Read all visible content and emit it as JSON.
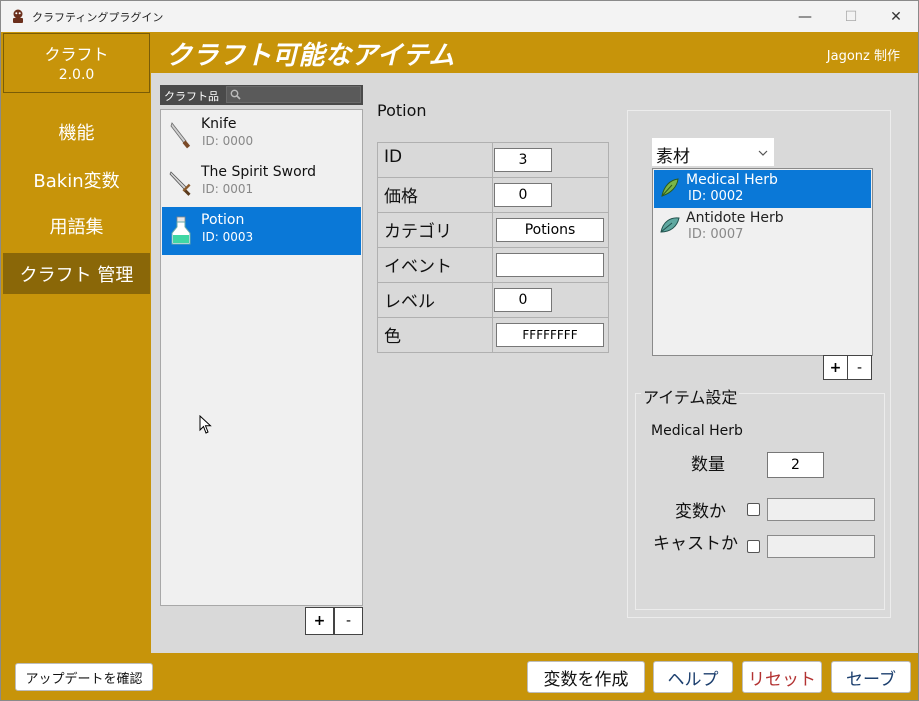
{
  "window": {
    "title": "クラフティングプラグイン",
    "controls": {
      "minimize": "—",
      "maximize": "☐",
      "close": "✕"
    }
  },
  "sidebar": {
    "app_name": "クラフト",
    "version": "2.0.0",
    "items": [
      {
        "label": "機能",
        "active": false
      },
      {
        "label": "Bakin変数",
        "active": false
      },
      {
        "label": "用語集",
        "active": false
      },
      {
        "label": "クラフト 管理",
        "active": true
      }
    ]
  },
  "header": {
    "title": "クラフト可能なアイテム",
    "author": "Jagonz 制作"
  },
  "craft_list": {
    "header_label": "クラフト品",
    "search_placeholder": "",
    "items": [
      {
        "name": "Knife",
        "id": "ID: 0000",
        "icon": "knife-icon",
        "selected": false
      },
      {
        "name": "The Spirit Sword",
        "id": "ID: 0001",
        "icon": "sword-icon",
        "selected": false
      },
      {
        "name": "Potion",
        "id": "ID: 0003",
        "icon": "potion-icon",
        "selected": true
      }
    ],
    "add_label": "+",
    "remove_label": "-"
  },
  "details": {
    "title": "Potion",
    "properties": [
      {
        "key": "ID",
        "value": "3"
      },
      {
        "key": "価格",
        "value": "0"
      },
      {
        "key": "カテゴリ",
        "value": "Potions"
      },
      {
        "key": "イベント",
        "value": ""
      },
      {
        "key": "レベル",
        "value": "0"
      },
      {
        "key": "色",
        "value": "FFFFFFFF"
      }
    ]
  },
  "ingredients": {
    "dropdown_value": "素材",
    "items": [
      {
        "name": "Medical Herb",
        "id": "ID: 0002",
        "icon": "herb-icon",
        "selected": true
      },
      {
        "name": "Antidote Herb",
        "id": "ID: 0007",
        "icon": "antidote-herb-icon",
        "selected": false
      }
    ],
    "add_label": "+",
    "remove_label": "-"
  },
  "item_settings": {
    "title": "アイテム設定",
    "selected_name": "Medical Herb",
    "quantity_label": "数量",
    "quantity_value": "2",
    "variable_label": "変数か",
    "variable_checked": false,
    "variable_value": "",
    "cast_label": "キャストか",
    "cast_checked": false,
    "cast_value": ""
  },
  "footer": {
    "check_update": "アップデートを確認",
    "create_variable": "変数を作成",
    "help": "ヘルプ",
    "reset": "リセット",
    "save": "セーブ"
  },
  "colors": {
    "accent": "#c7940a",
    "accent_dark": "#8a6708",
    "selection": "#0a78d7",
    "panel": "#d9d9d9"
  }
}
